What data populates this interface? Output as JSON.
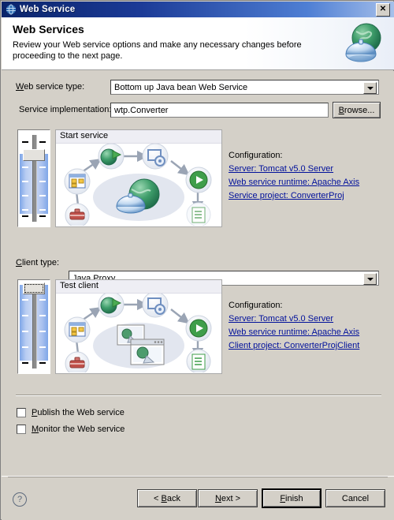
{
  "window": {
    "title": "Web Service",
    "title_icon": "globe-icon",
    "close_label": "✕"
  },
  "header": {
    "title": "Web Services",
    "description": "Review your Web service options and make any necessary changes before proceeding to the next page.",
    "icon": "globe-service-icon"
  },
  "form": {
    "service_type_label": "Web service type:",
    "service_type_value": "Bottom up Java bean Web Service",
    "service_impl_label": "Service implementation:",
    "service_impl_value": "wtp.Converter",
    "browse_label": "Browse...",
    "client_type_label": "Client type:",
    "client_type_value": "Java Proxy"
  },
  "service_panel": {
    "diagram_title": "Start service",
    "slider_name": "service-generation-slider",
    "config_title": "Configuration:",
    "links": [
      "Server: Tomcat v5.0 Server",
      "Web service runtime: Apache Axis",
      "Service project: ConverterProj"
    ]
  },
  "client_panel": {
    "diagram_title": "Test client",
    "slider_name": "client-generation-slider",
    "config_title": "Configuration:",
    "links": [
      "Server: Tomcat v5.0 Server",
      "Web service runtime: Apache Axis",
      "Client project: ConverterProjClient"
    ]
  },
  "options": {
    "publish_label": "Publish the Web service",
    "publish_checked": false,
    "monitor_label": "Monitor the Web service",
    "monitor_checked": false
  },
  "footer": {
    "help_label": "?",
    "back_label": "< Back",
    "next_label": "Next >",
    "finish_label": "Finish",
    "cancel_label": "Cancel"
  },
  "colors": {
    "title_bar": "#1b3a96",
    "body": "#d4d0c8",
    "link": "#00109b",
    "slider_fill": "#a8c0ee"
  }
}
